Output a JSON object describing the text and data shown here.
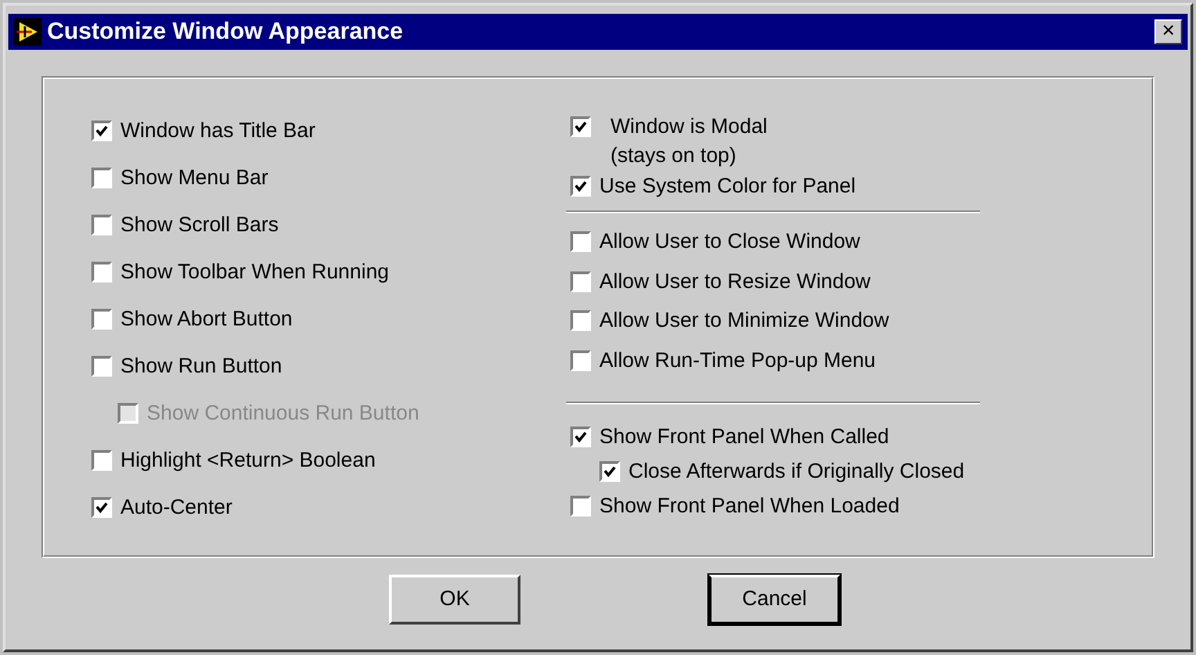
{
  "window": {
    "title": "Customize Window Appearance",
    "close": "×"
  },
  "left": [
    {
      "label": "Window has Title Bar",
      "checked": true,
      "disabled": false
    },
    {
      "label": "Show Menu Bar",
      "checked": false,
      "disabled": false
    },
    {
      "label": "Show Scroll Bars",
      "checked": false,
      "disabled": false
    },
    {
      "label": "Show Toolbar When Running",
      "checked": false,
      "disabled": false
    },
    {
      "label": "Show Abort Button",
      "checked": false,
      "disabled": false
    },
    {
      "label": "Show Run Button",
      "checked": false,
      "disabled": false,
      "children": [
        {
          "label": "Show Continuous Run Button",
          "checked": false,
          "disabled": true
        }
      ]
    },
    {
      "label": "Highlight <Return> Boolean",
      "checked": false,
      "disabled": false
    },
    {
      "label": "Auto-Center",
      "checked": true,
      "disabled": false
    }
  ],
  "right_groups": [
    [
      {
        "label": "Window is Modal",
        "note": "(stays on top)",
        "checked": true,
        "disabled": false
      },
      {
        "label": "Use System Color for Panel",
        "checked": true,
        "disabled": false
      }
    ],
    [
      {
        "label": "Allow User to Close Window",
        "checked": false,
        "disabled": false
      },
      {
        "label": "Allow User to Resize Window",
        "checked": false,
        "disabled": false
      },
      {
        "label": "Allow User to Minimize Window",
        "checked": false,
        "disabled": false
      },
      {
        "label": "Allow Run-Time Pop-up Menu",
        "checked": false,
        "disabled": false
      }
    ],
    [
      {
        "label": "Show Front Panel When Called",
        "checked": true,
        "disabled": false,
        "children": [
          {
            "label": "Close Afterwards if Originally Closed",
            "checked": true,
            "disabled": false
          }
        ]
      },
      {
        "label": "Show Front Panel When Loaded",
        "checked": false,
        "disabled": false
      }
    ]
  ],
  "buttons": [
    {
      "label": "OK",
      "default": false
    },
    {
      "label": "Cancel",
      "default": true
    }
  ]
}
